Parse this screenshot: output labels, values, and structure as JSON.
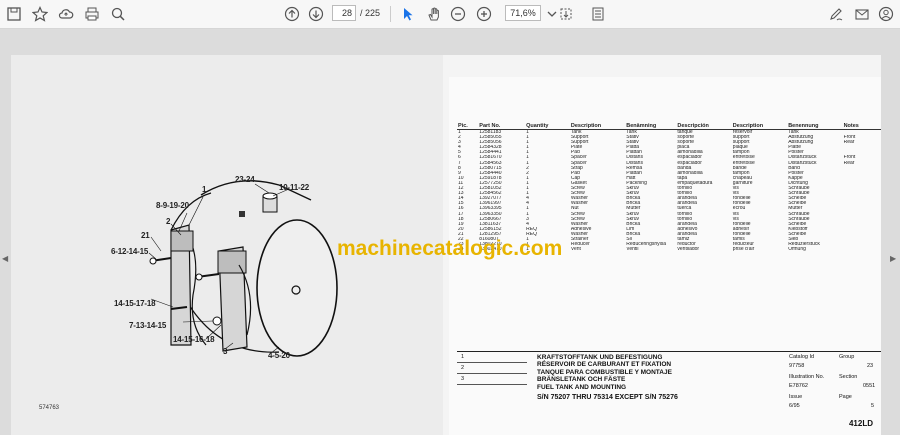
{
  "toolbar": {
    "page_current": "28",
    "page_total": "/ 225",
    "zoom": "71,6%"
  },
  "drawing": {
    "callouts": [
      "23-24",
      "10-11-22",
      "1",
      "8-9-19-20",
      "2",
      "21",
      "6-12-14-15",
      "14-15-17-18",
      "7-13-14-15",
      "14-15-16-18",
      "3",
      "4-5-20"
    ],
    "figure_id": "574763"
  },
  "parts_table": {
    "headers": [
      "Pic.",
      "Part No.",
      "Quantity",
      "Description",
      "Benämning",
      "Descripción",
      "Description",
      "Benennung",
      "Notes"
    ],
    "rows": [
      [
        "1",
        "12581183",
        "1",
        "Tank",
        "Tank",
        "tanque",
        "réservoir",
        "Tank",
        ""
      ],
      [
        "2",
        "12585055",
        "1",
        "Support",
        "Stativ",
        "soporte",
        "support",
        "Abstützung",
        "Front"
      ],
      [
        "3",
        "12585056",
        "1",
        "Support",
        "Stativ",
        "soporte",
        "support",
        "Abstützung",
        "Rear"
      ],
      [
        "4",
        "12584328",
        "1",
        "Plate",
        "Platta",
        "placa",
        "plaque",
        "Platte",
        ""
      ],
      [
        "5",
        "12584441",
        "1",
        "Pad",
        "Plattan",
        "almohadilla",
        "tampon",
        "Polster",
        ""
      ],
      [
        "6",
        "12581670",
        "1",
        "Spacer",
        "Distans",
        "espaciador",
        "entretoise",
        "Distanzstück",
        "Front"
      ],
      [
        "7",
        "12584563",
        "1",
        "Spacer",
        "Distans",
        "espaciador",
        "entretoise",
        "Distanzstück",
        "Rear"
      ],
      [
        "8",
        "12580715",
        "2",
        "Strap",
        "Remsa",
        "banda",
        "bande",
        "Band",
        ""
      ],
      [
        "9",
        "12584440",
        "2",
        "Pad",
        "Plattan",
        "almohadilla",
        "tampon",
        "Polster",
        ""
      ],
      [
        "10",
        "12591878",
        "1",
        "Cap",
        "Hatt",
        "tapa",
        "chapeau",
        "Kappe",
        ""
      ],
      [
        "11",
        "12577250",
        "1",
        "Gasket",
        "Packning",
        "empaquetadura",
        "garniture",
        "Dichtung",
        ""
      ],
      [
        "12",
        "12581052",
        "1",
        "Screw",
        "Skruv",
        "tornillo",
        "vis",
        "Schraube",
        ""
      ],
      [
        "13",
        "12584562",
        "1",
        "Screw",
        "Skruv",
        "tornillo",
        "vis",
        "Schraube",
        ""
      ],
      [
        "14",
        "13927077",
        "4",
        "Washer",
        "Bricka",
        "arandela",
        "rondelle",
        "Scheibe",
        ""
      ],
      [
        "15",
        "13961997",
        "4",
        "Washer",
        "Bricka",
        "arandela",
        "rondelle",
        "Scheibe",
        ""
      ],
      [
        "16",
        "13963395",
        "1",
        "Nut",
        "Mutter",
        "tuerca",
        "écrou",
        "Mutter",
        ""
      ],
      [
        "17",
        "13963350",
        "1",
        "Screw",
        "Skruv",
        "tornillo",
        "vis",
        "Schraube",
        ""
      ],
      [
        "18",
        "12580667",
        "3",
        "Screw",
        "Skruv",
        "tornillo",
        "vis",
        "Schraube",
        ""
      ],
      [
        "19",
        "13811637",
        "4",
        "Washer",
        "Bricka",
        "arandela",
        "rondelle",
        "Scheibe",
        ""
      ],
      [
        "20",
        "12586152",
        "REQ",
        "Adhesive",
        "Lim",
        "adhesivo",
        "adhésif",
        "Klebstoff",
        ""
      ],
      [
        "21",
        "12812957",
        "REQ",
        "Washer",
        "Bricka",
        "arandela",
        "rondelle",
        "Scheibe",
        ""
      ],
      [
        "22",
        "8160807",
        "1",
        "Strainer",
        "Sil",
        "tamiz",
        "tamis",
        "Sieb",
        ""
      ],
      [
        "23",
        "13802270",
        "1",
        "Reducer",
        "Reduceringshylsa",
        "reductor",
        "réducteur",
        "Reduzierstück",
        ""
      ],
      [
        "24",
        "13802470",
        "1",
        "Vent",
        "Ventil",
        "ventilador",
        "prise d'air",
        "Öffnung",
        ""
      ]
    ]
  },
  "title_block": {
    "revisions": [
      "1",
      "2",
      "3"
    ],
    "titles": [
      "KRAFTSTOFFTANK UND BEFESTIGUNG",
      "RÉSERVOIR DE CARBURANT ET FIXATION",
      "TANQUE PARA COMBUSTIBLE Y MONTAJE",
      "BRÄNSLETANK OCH FÄSTE",
      "FUEL TANK AND MOUNTING"
    ],
    "serial": "S/N 75207 THRU 75314 EXCEPT S/N 75276",
    "catalog_id_label": "Catalog Id",
    "catalog_id": "97758",
    "group_label": "Group",
    "group": "23",
    "illustration_label": "Illustration No.",
    "illustration": "E78762",
    "section_label": "Section",
    "section": "0551",
    "issue_label": "Issue",
    "issue": "6/95",
    "page_label": "Page",
    "page": "5",
    "model": "412LD"
  },
  "watermark": "machinecatalogic.com",
  "colors": {
    "watermark": "#e8b400",
    "accent": "#1a73e8"
  }
}
